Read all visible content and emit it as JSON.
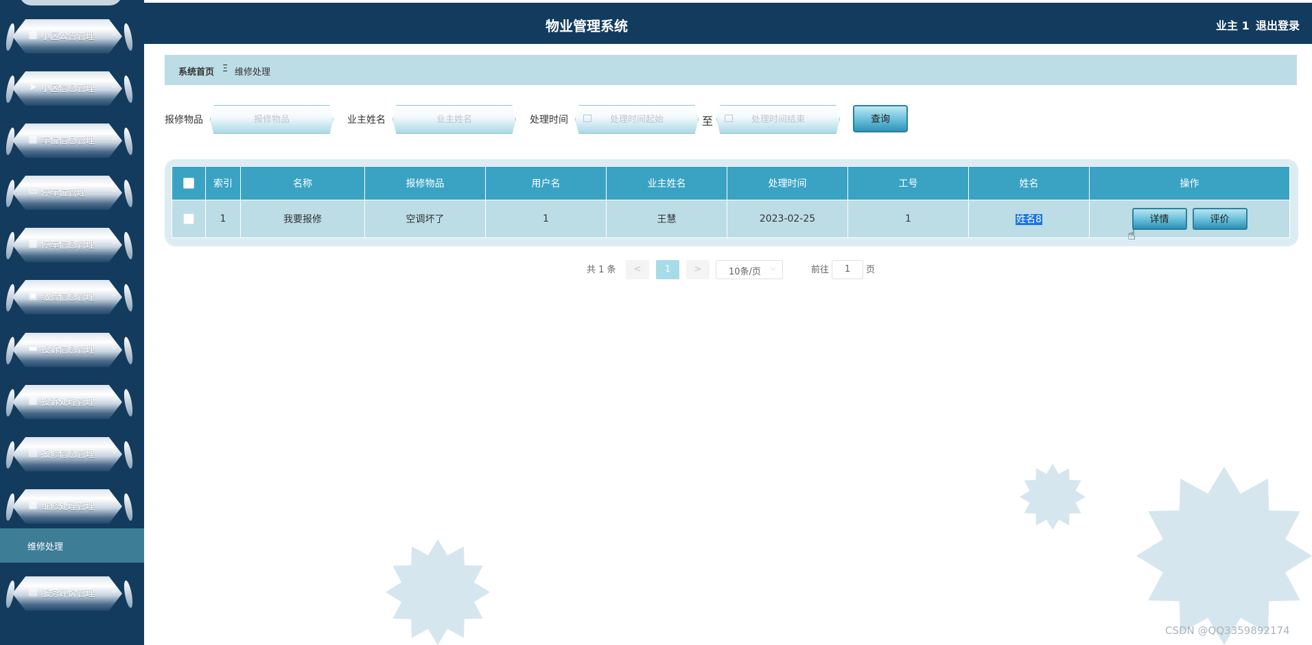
{
  "header": {
    "title": "物业管理系统",
    "user": "业主 1",
    "logout": "退出登录"
  },
  "sidebar": {
    "items": [
      {
        "label": "小区公告管理",
        "icon": "grid-icon",
        "glyph": "▦",
        "chev": "⌵"
      },
      {
        "label": "小区信息管理",
        "icon": "send-icon",
        "glyph": "➤",
        "chev": "⌵"
      },
      {
        "label": "车位信息管理",
        "icon": "grid-icon",
        "glyph": "▦",
        "chev": "⌵"
      },
      {
        "label": "停车位管理",
        "icon": "monitor-icon",
        "glyph": "▭",
        "chev": "⌵"
      },
      {
        "label": "停车信息管理",
        "icon": "grid-icon",
        "glyph": "▦",
        "chev": "⌵"
      },
      {
        "label": "缴费信息管理",
        "icon": "chat-icon",
        "glyph": "▣",
        "chev": "⌵"
      },
      {
        "label": "投诉信息管理",
        "icon": "ticket-icon",
        "glyph": "▬",
        "chev": "⌵"
      },
      {
        "label": "投诉处理管理",
        "icon": "grid-icon",
        "glyph": "▦",
        "chev": "⌵"
      },
      {
        "label": "报修信息管理",
        "icon": "clipboard-icon",
        "glyph": "▤",
        "chev": "⌵"
      },
      {
        "label": "维修处理管理",
        "icon": "grid-icon",
        "glyph": "▦",
        "chev": "⌃"
      },
      {
        "label": "服务评价管理",
        "icon": "clipboard-icon",
        "glyph": "▤",
        "chev": "⌵"
      }
    ],
    "sub_item": "维修处理"
  },
  "breadcrumb": {
    "home": "系统首页",
    "sep": "Ξ",
    "current": "维修处理"
  },
  "search": {
    "item_label": "报修物品",
    "item_placeholder": "报修物品",
    "owner_label": "业主姓名",
    "owner_placeholder": "业主姓名",
    "time_label": "处理时间",
    "time_start_placeholder": "处理时间起始",
    "time_to": "至",
    "time_end_placeholder": "处理时间结束",
    "query_button": "查询"
  },
  "table": {
    "headers": [
      "索引",
      "名称",
      "报修物品",
      "用户名",
      "业主姓名",
      "处理时间",
      "工号",
      "姓名",
      "操作"
    ],
    "rows": [
      {
        "index": "1",
        "name": "我要报修",
        "item": "空调坏了",
        "username": "1",
        "owner": "王慧",
        "time": "2023-02-25",
        "worker_id": "1",
        "worker_name": "姓名8"
      }
    ],
    "detail_button": "详情",
    "rate_button": "评价"
  },
  "pagination": {
    "total": "共 1 条",
    "prev": "<",
    "page": "1",
    "next": ">",
    "size": "10条/页",
    "goto": "前往",
    "goto_value": "1",
    "page_suffix": "页"
  },
  "watermark": "CSDN @QQ3359892174",
  "colors": {
    "primary_dark": "#123b5e",
    "accent": "#3aa3c4",
    "row_bg": "#bcdde6"
  }
}
